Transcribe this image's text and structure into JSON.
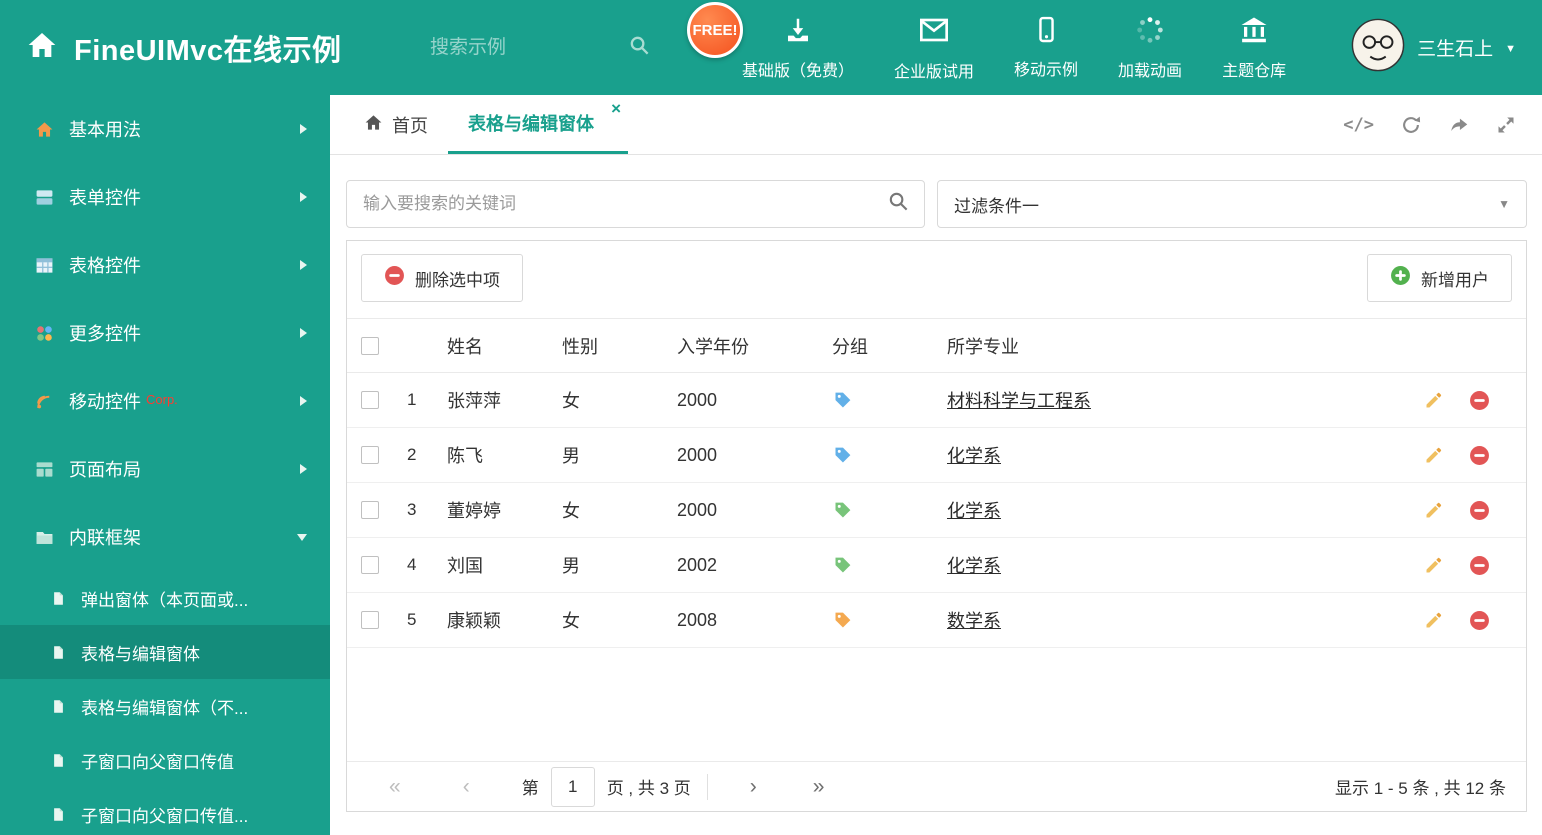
{
  "colors": {
    "theme": "#19A08D",
    "sidebar_selected": "#148C7B",
    "tag_blue": "#62B0E8",
    "tag_green": "#78C47A",
    "tag_orange": "#F4A950",
    "delete_red": "#E25555",
    "add_green": "#52B14E"
  },
  "header": {
    "title": "FineUIMvc在线示例",
    "search_placeholder": "搜索示例",
    "free_badge": "FREE!",
    "nav": [
      {
        "label": "基础版（免费）",
        "icon": "download-icon"
      },
      {
        "label": "企业版试用",
        "icon": "envelope-icon"
      },
      {
        "label": "移动示例",
        "icon": "mobile-icon"
      },
      {
        "label": "加载动画",
        "icon": "spinner-icon"
      },
      {
        "label": "主题仓库",
        "icon": "bank-icon"
      }
    ],
    "user": {
      "name": "三生石上",
      "caret": "▼"
    }
  },
  "sidebar": {
    "items": [
      {
        "label": "基本用法"
      },
      {
        "label": "表单控件"
      },
      {
        "label": "表格控件"
      },
      {
        "label": "更多控件"
      },
      {
        "label": "移动控件",
        "badge": "Corp."
      },
      {
        "label": "页面布局"
      },
      {
        "label": "内联框架",
        "expanded": true
      }
    ],
    "subitems": [
      {
        "label": "弹出窗体（本页面或..."
      },
      {
        "label": "表格与编辑窗体",
        "selected": true
      },
      {
        "label": "表格与编辑窗体（不..."
      },
      {
        "label": "子窗口向父窗口传值"
      },
      {
        "label": "子窗口向父窗口传值..."
      }
    ]
  },
  "tabbar": {
    "home_tab": "首页",
    "active_tab": "表格与编辑窗体",
    "close_glyph": "×",
    "code_glyph": "</>"
  },
  "filters": {
    "keyword_placeholder": "输入要搜索的关键词",
    "filter_value": "过滤条件一",
    "caret": "▼"
  },
  "toolbar": {
    "delete_label": "删除选中项",
    "add_label": "新增用户"
  },
  "grid": {
    "columns": [
      "姓名",
      "性别",
      "入学年份",
      "分组",
      "所学专业"
    ],
    "rows": [
      {
        "index": "1",
        "name": "张萍萍",
        "gender": "女",
        "year": "2000",
        "tag_color": "#62B0E8",
        "major": "材料科学与工程系"
      },
      {
        "index": "2",
        "name": "陈飞",
        "gender": "男",
        "year": "2000",
        "tag_color": "#62B0E8",
        "major": "化学系"
      },
      {
        "index": "3",
        "name": "董婷婷",
        "gender": "女",
        "year": "2000",
        "tag_color": "#78C47A",
        "major": "化学系"
      },
      {
        "index": "4",
        "name": "刘国",
        "gender": "男",
        "year": "2002",
        "tag_color": "#78C47A",
        "major": "化学系"
      },
      {
        "index": "5",
        "name": "康颖颖",
        "gender": "女",
        "year": "2008",
        "tag_color": "#F4A950",
        "major": "数学系"
      }
    ]
  },
  "pagination": {
    "first": "«",
    "prev": "‹",
    "next": "›",
    "last": "»",
    "page_label": "第",
    "page_value": "1",
    "page_suffix": "页 , 共 3 页",
    "summary": "显示 1 - 5 条 , 共 12 条"
  }
}
